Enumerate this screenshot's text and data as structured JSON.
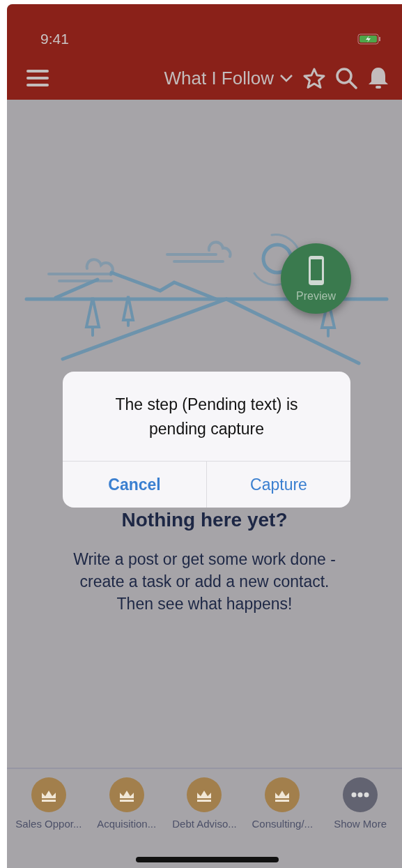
{
  "status_bar": {
    "time": "9:41"
  },
  "header": {
    "title": "What I Follow"
  },
  "empty_state": {
    "heading": "Nothing here yet?",
    "body": "Write a post or get some work done - create a task or add a new contact. Then see what happens!"
  },
  "preview_button": {
    "label": "Preview"
  },
  "dialog": {
    "message": "The step (Pending text) is pending capture",
    "buttons": [
      {
        "label": "Cancel",
        "kind": "cancel"
      },
      {
        "label": "Capture",
        "kind": "default"
      }
    ]
  },
  "nav_items": [
    {
      "label": "Sales Oppor...",
      "kind": "object"
    },
    {
      "label": "Acquisition...",
      "kind": "object"
    },
    {
      "label": "Debt Adviso...",
      "kind": "object"
    },
    {
      "label": "Consulting/...",
      "kind": "object"
    },
    {
      "label": "Show More",
      "kind": "more"
    }
  ]
}
